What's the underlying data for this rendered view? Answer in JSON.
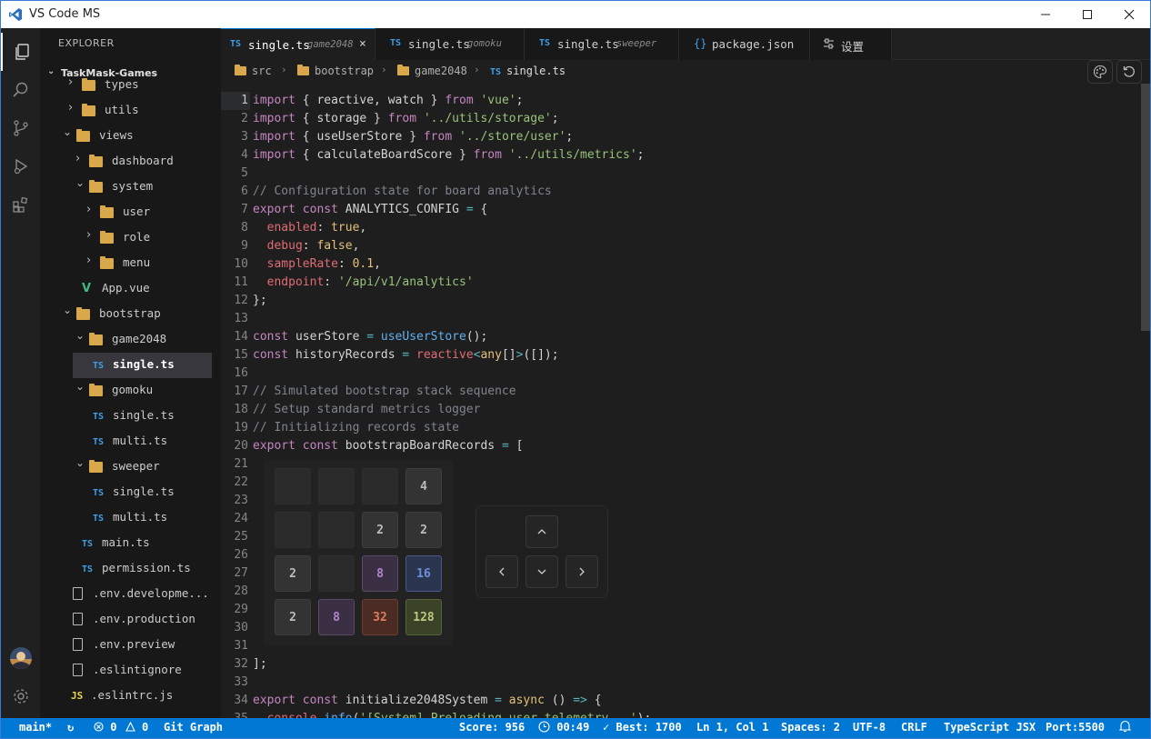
{
  "window": {
    "title": "VS Code MS"
  },
  "colors": {
    "accent": "#0078d4",
    "folder": "#d9a84a",
    "ts": "#3fa0e8"
  },
  "activity_bar": {
    "icons": [
      "explorer-icon",
      "search-icon",
      "source-control-icon",
      "run-debug-icon",
      "extensions-icon",
      "account-avatar",
      "settings-gear-icon"
    ]
  },
  "explorer": {
    "title": "EXPLORER",
    "root": "TaskMask-Games",
    "items": [
      {
        "label": "types",
        "kind": "folder",
        "state": "collapsed"
      },
      {
        "label": "utils",
        "kind": "folder",
        "state": "collapsed"
      },
      {
        "label": "views",
        "kind": "folder",
        "state": "expanded"
      },
      {
        "label": "dashboard",
        "kind": "folder",
        "state": "collapsed"
      },
      {
        "label": "system",
        "kind": "folder",
        "state": "expanded"
      },
      {
        "label": "user",
        "kind": "folder",
        "state": "collapsed"
      },
      {
        "label": "role",
        "kind": "folder",
        "state": "collapsed"
      },
      {
        "label": "menu",
        "kind": "folder",
        "state": "collapsed"
      },
      {
        "label": "App.vue",
        "kind": "vue"
      },
      {
        "label": "bootstrap",
        "kind": "folder",
        "state": "expanded"
      },
      {
        "label": "game2048",
        "kind": "folder",
        "state": "expanded"
      },
      {
        "label": "single.ts",
        "kind": "ts",
        "selected": true
      },
      {
        "label": "gomoku",
        "kind": "folder",
        "state": "expanded"
      },
      {
        "label": "single.ts",
        "kind": "ts"
      },
      {
        "label": "multi.ts",
        "kind": "ts"
      },
      {
        "label": "sweeper",
        "kind": "folder",
        "state": "expanded"
      },
      {
        "label": "single.ts",
        "kind": "ts"
      },
      {
        "label": "multi.ts",
        "kind": "ts"
      },
      {
        "label": "main.ts",
        "kind": "ts"
      },
      {
        "label": "permission.ts",
        "kind": "ts"
      },
      {
        "label": ".env.developme...",
        "kind": "file"
      },
      {
        "label": ".env.production",
        "kind": "file"
      },
      {
        "label": ".env.preview",
        "kind": "file"
      },
      {
        "label": ".eslintignore",
        "kind": "file"
      },
      {
        "label": ".eslintrc.js",
        "kind": "js"
      }
    ]
  },
  "tabs": [
    {
      "icon": "TS",
      "name": "single.ts",
      "sub": "game2048",
      "active": true,
      "close": "×"
    },
    {
      "icon": "TS",
      "name": "single.ts",
      "sub": "gomoku"
    },
    {
      "icon": "TS",
      "name": "single.ts",
      "sub": "sweeper"
    },
    {
      "icon": "{}",
      "name": "package.json"
    },
    {
      "icon": "settings-sliders-icon",
      "name": "设置"
    }
  ],
  "breadcrumb": [
    "src",
    "bootstrap",
    "game2048",
    "single.ts"
  ],
  "breadcrumb_file_icon": "TS",
  "editor": {
    "current_line": 1,
    "line_numbers": [
      "1",
      "2",
      "3",
      "4",
      "5",
      "6",
      "7",
      "8",
      "9",
      "10",
      "11",
      "12",
      "13",
      "14",
      "15",
      "16",
      "17",
      "18",
      "19",
      "20",
      "21",
      "22",
      "23",
      "24",
      "25",
      "26",
      "27",
      "28",
      "29",
      "30",
      "31",
      "32",
      "33",
      "34",
      "35"
    ]
  },
  "game2048": {
    "cells": [
      [
        "",
        "",
        "",
        "4"
      ],
      [
        "",
        "",
        "2",
        "2"
      ],
      [
        "2",
        "",
        "8",
        "16"
      ],
      [
        "2",
        "8",
        "32",
        "128"
      ]
    ],
    "controls": [
      "arrow-up-icon",
      "arrow-left-icon",
      "arrow-down-icon",
      "arrow-right-icon"
    ]
  },
  "status_bar": {
    "branch": "main*",
    "sync_icon": "sync-icon",
    "errors": "0",
    "warnings": "0",
    "git_graph": "Git Graph",
    "score": "Score: 956",
    "timer": "00:49",
    "best": "Best: 1700",
    "cursor": "Ln 1, Col 1",
    "spaces": "Spaces: 2",
    "encoding": "UTF-8",
    "eol": "CRLF",
    "language": "TypeScript JSX",
    "port": "Port:5500"
  }
}
